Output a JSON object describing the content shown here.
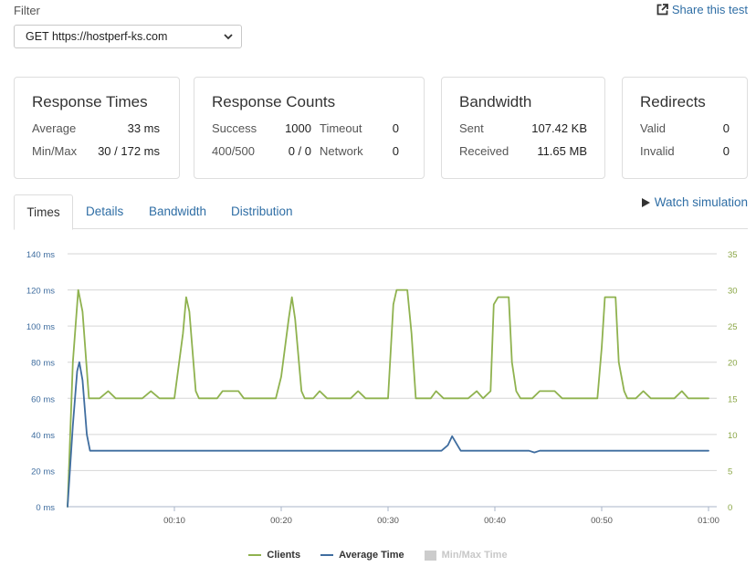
{
  "filter": {
    "label": "Filter",
    "selected": "GET https://hostperf-ks.com"
  },
  "share": {
    "label": "Share this test",
    "icon": "external-link-icon"
  },
  "cards": {
    "response_times": {
      "title": "Response Times",
      "average_label": "Average",
      "average_value": "33 ms",
      "minmax_label": "Min/Max",
      "minmax_value": "30 / 172 ms"
    },
    "response_counts": {
      "title": "Response Counts",
      "success_label": "Success",
      "success_value": "1000",
      "timeout_label": "Timeout",
      "timeout_value": "0",
      "status_label": "400/500",
      "status_value": "0 / 0",
      "network_label": "Network",
      "network_value": "0"
    },
    "bandwidth": {
      "title": "Bandwidth",
      "sent_label": "Sent",
      "sent_value": "107.42 KB",
      "received_label": "Received",
      "received_value": "11.65 MB"
    },
    "redirects": {
      "title": "Redirects",
      "valid_label": "Valid",
      "valid_value": "0",
      "invalid_label": "Invalid",
      "invalid_value": "0"
    }
  },
  "tabs": [
    {
      "label": "Times",
      "active": true
    },
    {
      "label": "Details",
      "active": false
    },
    {
      "label": "Bandwidth",
      "active": false
    },
    {
      "label": "Distribution",
      "active": false
    }
  ],
  "watch_simulation": {
    "label": "Watch simulation",
    "icon": "play-icon"
  },
  "colors": {
    "clients": "#8fb24f",
    "average_time": "#3f6d9f",
    "minmax": "#cccccc",
    "link": "#2f6ea5",
    "grid": "#d6d6d6",
    "left_axis": "#3f6d9f",
    "right_axis": "#8aa645"
  },
  "chart_data": {
    "type": "line",
    "x_ticks": [
      "00:10",
      "00:20",
      "00:30",
      "00:40",
      "00:50",
      "01:00"
    ],
    "x_tick_seconds": [
      10,
      20,
      30,
      40,
      50,
      60
    ],
    "xlim": [
      0,
      60
    ],
    "y_left_ticks": [
      "0 ms",
      "20 ms",
      "40 ms",
      "60 ms",
      "80 ms",
      "100 ms",
      "120 ms",
      "140 ms"
    ],
    "y_left_lim": [
      0,
      140
    ],
    "y_right_ticks": [
      "0",
      "5",
      "10",
      "15",
      "20",
      "25",
      "30",
      "35"
    ],
    "y_right_lim": [
      0,
      35
    ],
    "grid": true,
    "legend_position": "bottom",
    "series": [
      {
        "name": "Clients",
        "axis": "right",
        "points": [
          [
            0,
            0
          ],
          [
            0.5,
            20
          ],
          [
            1,
            30
          ],
          [
            1.4,
            27
          ],
          [
            2,
            15
          ],
          [
            3,
            15
          ],
          [
            3.8,
            16
          ],
          [
            4.5,
            15
          ],
          [
            7,
            15
          ],
          [
            7.8,
            16
          ],
          [
            8.6,
            15
          ],
          [
            10,
            15
          ],
          [
            10.8,
            24
          ],
          [
            11.1,
            29
          ],
          [
            11.4,
            27
          ],
          [
            12,
            16
          ],
          [
            12.3,
            15
          ],
          [
            14,
            15
          ],
          [
            14.5,
            16
          ],
          [
            16,
            16
          ],
          [
            16.5,
            15
          ],
          [
            19.5,
            15
          ],
          [
            20,
            18
          ],
          [
            20.7,
            26
          ],
          [
            21,
            29
          ],
          [
            21.3,
            26
          ],
          [
            21.9,
            16
          ],
          [
            22.2,
            15
          ],
          [
            23,
            15
          ],
          [
            23.6,
            16
          ],
          [
            24.3,
            15
          ],
          [
            26.5,
            15
          ],
          [
            27.2,
            16
          ],
          [
            27.9,
            15
          ],
          [
            30,
            15
          ],
          [
            30.5,
            28
          ],
          [
            30.8,
            30
          ],
          [
            31.8,
            30
          ],
          [
            32.2,
            24
          ],
          [
            32.6,
            15
          ],
          [
            34,
            15
          ],
          [
            34.5,
            16
          ],
          [
            35.2,
            15
          ],
          [
            37.5,
            15
          ],
          [
            38.3,
            16
          ],
          [
            38.9,
            15
          ],
          [
            39.6,
            16
          ],
          [
            39.9,
            28
          ],
          [
            40.3,
            29
          ],
          [
            41.3,
            29
          ],
          [
            41.6,
            20
          ],
          [
            42,
            16
          ],
          [
            42.4,
            15
          ],
          [
            43.5,
            15
          ],
          [
            44.2,
            16
          ],
          [
            45.6,
            16
          ],
          [
            46.3,
            15
          ],
          [
            49.6,
            15
          ],
          [
            50,
            22
          ],
          [
            50.3,
            29
          ],
          [
            51.3,
            29
          ],
          [
            51.6,
            20
          ],
          [
            52.1,
            16
          ],
          [
            52.4,
            15
          ],
          [
            53.2,
            15
          ],
          [
            53.9,
            16
          ],
          [
            54.6,
            15
          ],
          [
            56.8,
            15
          ],
          [
            57.5,
            16
          ],
          [
            58.1,
            15
          ],
          [
            60,
            15
          ]
        ]
      },
      {
        "name": "Average Time",
        "axis": "left",
        "points": [
          [
            0,
            0
          ],
          [
            0.5,
            45
          ],
          [
            0.9,
            75
          ],
          [
            1.1,
            80
          ],
          [
            1.4,
            70
          ],
          [
            1.8,
            40
          ],
          [
            2.1,
            31
          ],
          [
            35,
            31
          ],
          [
            35.6,
            34
          ],
          [
            36,
            39
          ],
          [
            36.4,
            35
          ],
          [
            36.8,
            31
          ],
          [
            43.2,
            31
          ],
          [
            43.7,
            30
          ],
          [
            44.2,
            31
          ],
          [
            60,
            31
          ]
        ]
      },
      {
        "name": "Min/Max Time",
        "axis": "left",
        "visible": false,
        "points": []
      }
    ]
  }
}
